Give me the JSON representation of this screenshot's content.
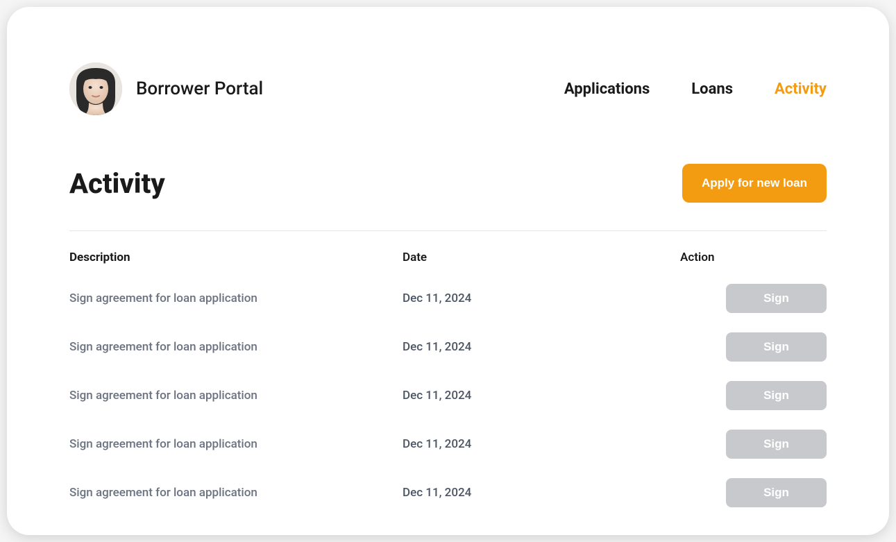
{
  "header": {
    "title": "Borrower Portal",
    "nav": [
      {
        "label": "Applications",
        "active": false
      },
      {
        "label": "Loans",
        "active": false
      },
      {
        "label": "Activity",
        "active": true
      }
    ]
  },
  "page": {
    "title": "Activity",
    "apply_button": "Apply for new loan"
  },
  "table": {
    "columns": {
      "description": "Description",
      "date": "Date",
      "action": "Action"
    },
    "rows": [
      {
        "description": "Sign agreement for loan application",
        "date": "Dec 11, 2024",
        "action_label": "Sign"
      },
      {
        "description": "Sign agreement for loan application",
        "date": "Dec 11, 2024",
        "action_label": "Sign"
      },
      {
        "description": "Sign agreement for loan application",
        "date": "Dec 11, 2024",
        "action_label": "Sign"
      },
      {
        "description": "Sign agreement for loan application",
        "date": "Dec 11, 2024",
        "action_label": "Sign"
      },
      {
        "description": "Sign agreement for loan application",
        "date": "Dec 11, 2024",
        "action_label": "Sign"
      }
    ]
  }
}
